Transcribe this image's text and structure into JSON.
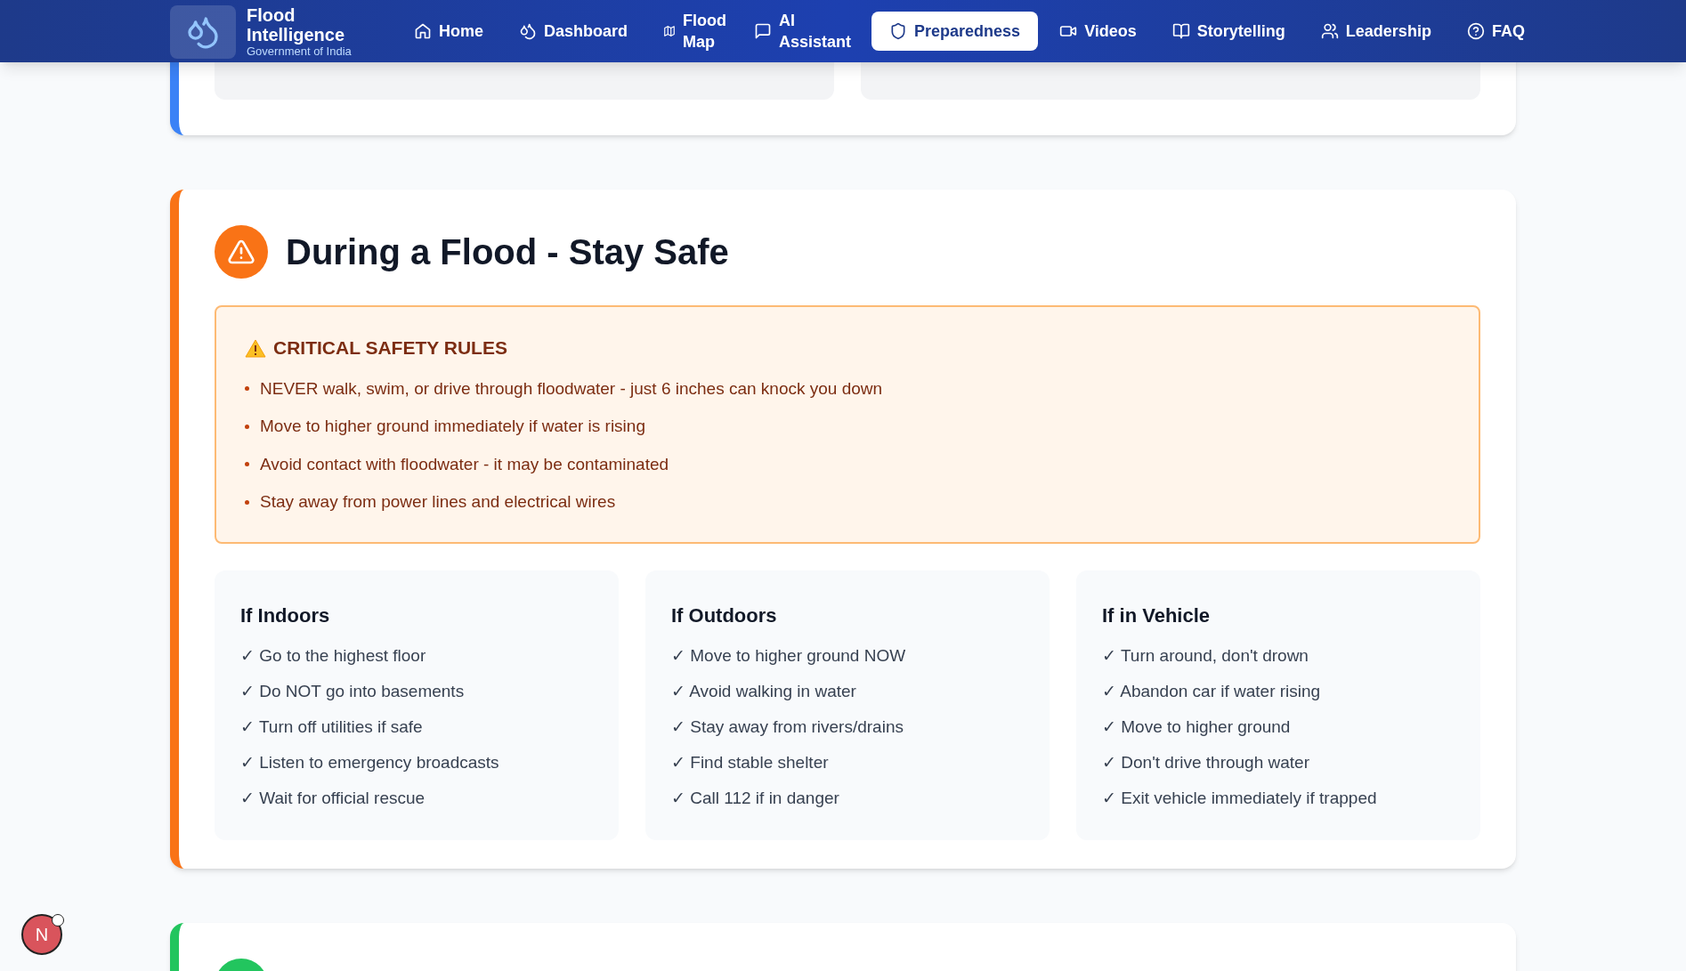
{
  "brand": {
    "title": "Flood Intelligence",
    "subtitle": "Government of India"
  },
  "nav": [
    {
      "label": "Home",
      "selected": false
    },
    {
      "label": "Dashboard",
      "selected": false
    },
    {
      "label": "Flood Map",
      "selected": false
    },
    {
      "label": "AI Assistant",
      "selected": false
    },
    {
      "label": "Preparedness",
      "selected": true
    },
    {
      "label": "Videos",
      "selected": false
    },
    {
      "label": "Storytelling",
      "selected": false
    },
    {
      "label": "Leadership",
      "selected": false
    },
    {
      "label": "FAQ",
      "selected": false
    }
  ],
  "section": {
    "title": "During a Flood - Stay Safe",
    "rules": {
      "title": "CRITICAL SAFETY RULES",
      "items": [
        "NEVER walk, swim, or drive through floodwater - just 6 inches can knock you down",
        "Move to higher ground immediately if water is rising",
        "Avoid contact with floodwater - it may be contaminated",
        "Stay away from power lines and electrical wires"
      ]
    },
    "groups": [
      {
        "title": "If Indoors",
        "items": [
          "✓ Go to the highest floor",
          "✓ Do NOT go into basements",
          "✓ Turn off utilities if safe",
          "✓ Listen to emergency broadcasts",
          "✓ Wait for official rescue"
        ]
      },
      {
        "title": "If Outdoors",
        "items": [
          "✓ Move to higher ground NOW",
          "✓ Avoid walking in water",
          "✓ Stay away from rivers/drains",
          "✓ Find stable shelter",
          "✓ Call 112 if in danger"
        ]
      },
      {
        "title": "If in Vehicle",
        "items": [
          "✓ Turn around, don't drown",
          "✓ Abandon car if water rising",
          "✓ Move to higher ground",
          "✓ Don't drive through water",
          "✓ Exit vehicle immediately if trapped"
        ]
      }
    ]
  },
  "dev_badge": {
    "letter": "N"
  }
}
